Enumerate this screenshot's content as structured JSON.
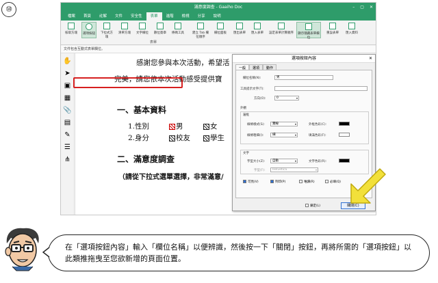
{
  "step": "⑩",
  "app": {
    "title": "滿意度調查 - Gaaiho Doc",
    "menu": [
      "檔案",
      "首頁",
      "註解",
      "文件",
      "安全性",
      "表單",
      "進階",
      "檢視",
      "分享",
      "說明"
    ],
    "active_menu": "表單",
    "ribbon_left": [
      "核取方塊",
      "選項按鈕",
      "下拉式方塊",
      "清單方塊",
      "文字欄位",
      "數位簽章",
      "條碼工具",
      "建立 Tab 欄位順序",
      "欄位面板"
    ],
    "ribbon_right": [
      "匯出表單",
      "匯入表單",
      "設定表單計算順序",
      "顯示隱藏表單欄位",
      "重設表單",
      "匯入資料"
    ],
    "ribbon_group_label": "表單",
    "field_hint": "文件包含互動式表單欄位。"
  },
  "document": {
    "line1": "感謝您參與本次活動，希望活",
    "line1_right": "下",
    "line2": "完美，請您依本次活動感受提供寶",
    "section1": "一、基本資料",
    "row1_label": "1.性別",
    "row1_opt1": "男",
    "row1_opt2": "女",
    "row2_label": "2.身分",
    "row2_opt1": "校友",
    "row2_opt2": "學生",
    "section2": "二、滿意度調查",
    "note": "（請從下拉式選單選擇，非常滿意/"
  },
  "dialog": {
    "title": "選項按鈕內容",
    "tabs": [
      "一般",
      "選項",
      "動作"
    ],
    "field_name_label": "欄位名稱(N):",
    "field_name_value": "男",
    "tooltip_label": "工具提示文字(T):",
    "page_label": "方向(O):",
    "page_value": "0",
    "appearance_label": "外觀",
    "border_label": "邊框",
    "line_style_label": "線條樣式(S):",
    "line_style_value": "實線",
    "line_color_label": "外框色彩(C):",
    "line_width_label": "線條粗細(I):",
    "line_width_value": "細",
    "fill_color_label": "填滿色彩(F):",
    "text_label": "文字",
    "font_size_label": "字型大小(Z):",
    "font_size_value": "自動",
    "text_color_label": "文字色彩(R):",
    "font_label": "字型(F):",
    "font_value": "Helvetica",
    "chk_visible": "可見(V)",
    "chk_print": "列印(P)",
    "chk_readonly": "唯讀(R)",
    "chk_required": "必填(Q)",
    "lock_label": "鎖定(L)",
    "close_label": "關閉(C)"
  },
  "caption": "在「選項按鈕內容」輸入「欄位名稱」以便辨識，然後按一下「關閉」按鈕，再將所需的「選項按鈕」以此類推拖曳至您欲新增的頁面位置。",
  "colors": {
    "brand": "#2e9c6a",
    "highlight": "#d61f1f",
    "arrow": "#f2e03a"
  }
}
